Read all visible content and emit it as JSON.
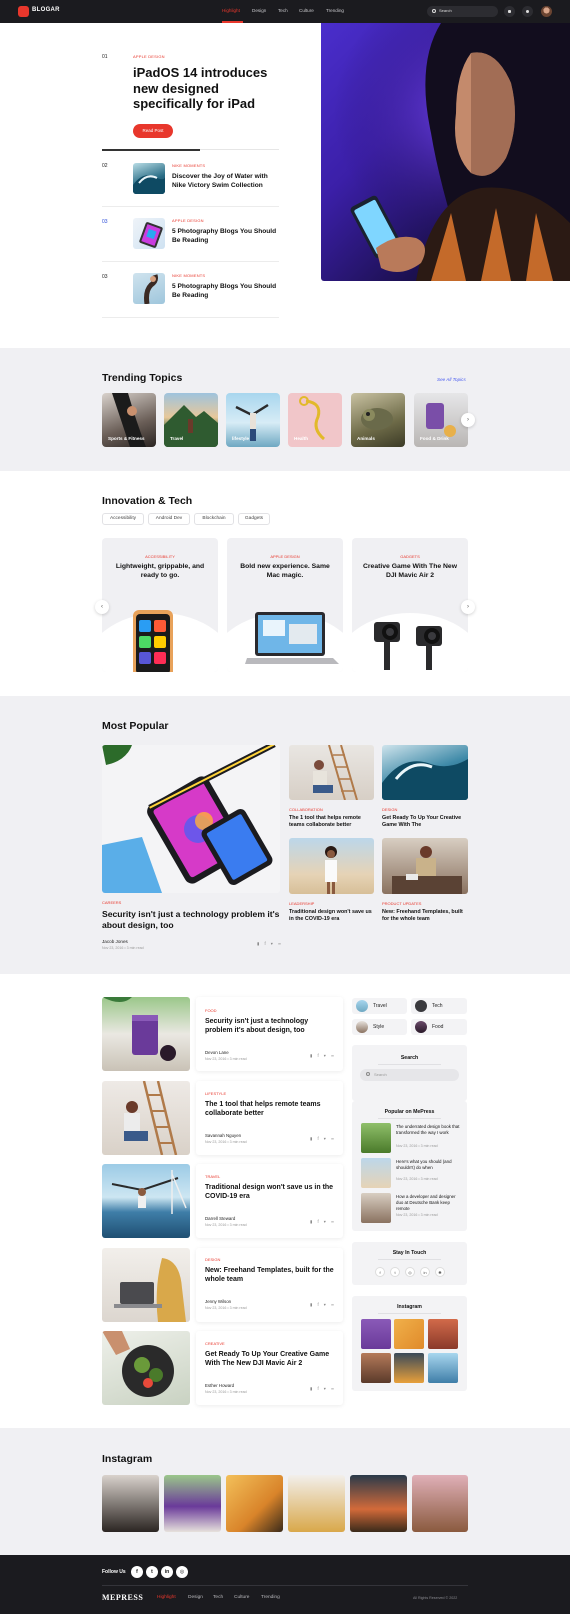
{
  "header": {
    "logo": "BLOGAR",
    "nav": [
      "Highlight",
      "Design",
      "Tech",
      "Culture",
      "Trending"
    ],
    "search_placeholder": "Search"
  },
  "hero": {
    "num": "01",
    "kicker": "APPLE DESIGN",
    "title": "iPadOS 14 introduces new designed specifically for iPad",
    "button": "Read Post",
    "items": [
      {
        "num": "02",
        "kicker": "NIKE MOMENTS",
        "title": "Discover the Joy of Water with Nike Victory Swim Collection"
      },
      {
        "num": "03",
        "kicker": "APPLE DESIGN",
        "title": "5 Photography Blogs You Should Be Reading"
      },
      {
        "num": "03",
        "kicker": "NIKE MOMENTS",
        "title": "5 Photography Blogs You Should Be Reading"
      }
    ]
  },
  "trending": {
    "title": "Trending Topics",
    "see_all": "See All Topics",
    "topics": [
      "Sports & Fitness",
      "Travel",
      "lifestyle",
      "Health",
      "Animals",
      "Food & Drink"
    ]
  },
  "innovation": {
    "title": "Innovation & Tech",
    "tabs": [
      "Accessibility",
      "Android Dev",
      "Blockchain",
      "Gadgets"
    ],
    "cards": [
      {
        "kicker": "ACCESSIBILITY",
        "title": "Lightweight, grippable, and ready to go."
      },
      {
        "kicker": "APPLE DESIGN",
        "title": "Bold new experience. Same Mac magic."
      },
      {
        "kicker": "GADGETS",
        "title": "Creative Game With The New DJI Mavic Air 2"
      }
    ]
  },
  "popular": {
    "title": "Most Popular",
    "main": {
      "kicker": "CAREERS",
      "title": "Security isn't just a technology problem it's about design, too",
      "author": "Jacob Jones",
      "meta": "Nov 23, 2016  •  3 min read"
    },
    "grid": [
      {
        "kicker": "COLLABORATION",
        "title": "The 1 tool that helps remote teams collaborate better"
      },
      {
        "kicker": "DESIGN",
        "title": "Get Ready To Up Your Creative Game With The"
      },
      {
        "kicker": "LEADERSHIP",
        "title": "Traditional design won't save us in the COVID-19 era"
      },
      {
        "kicker": "PRODUCT UPDATES",
        "title": "New: Freehand Templates, built for the whole team"
      }
    ]
  },
  "list": [
    {
      "kicker": "FOOD",
      "title": "Security isn't just a technology problem it's about design, too",
      "author": "Devon Lane",
      "meta": "Nov 23, 2016  •  3 min read"
    },
    {
      "kicker": "LIFESTYLE",
      "title": "The 1 tool that helps remote teams collaborate better",
      "author": "Savannah Nguyen",
      "meta": "Nov 23, 2016  •  3 min read"
    },
    {
      "kicker": "TRAVEL",
      "title": "Traditional design won't save us in the COVID-19 era",
      "author": "Darrell Steward",
      "meta": "Nov 23, 2016  •  3 min read"
    },
    {
      "kicker": "DESIGN",
      "title": "New: Freehand Templates, built for the whole team",
      "author": "Jenny Wilson",
      "meta": "Nov 23, 2016  •  3 min read"
    },
    {
      "kicker": "CREATIVE",
      "title": "Get Ready To Up Your Creative Game With The New DJI Mavic Air 2",
      "author": "Esther Howard",
      "meta": "Nov 23, 2016  •  3 min read"
    }
  ],
  "sidebar": {
    "categories": [
      "Travel",
      "Tech",
      "Style",
      "Food"
    ],
    "search_title": "Search",
    "search_placeholder": "Search",
    "popular_title": "Popular on MePress",
    "popular": [
      {
        "title": "The underrated design book that transformed the way I work",
        "meta": "Nov 23, 2016  •  3 min read"
      },
      {
        "title": "Here's what you should (and shouldn't) do when",
        "meta": "Nov 23, 2016  •  3 min read"
      },
      {
        "title": "How a developer and designer duo at Deutsche Bank keep remote",
        "meta": "Nov 23, 2016  •  3 min read"
      }
    ],
    "stay_title": "Stay In Touch",
    "instagram_title": "Instagram"
  },
  "instagram": {
    "title": "Instagram"
  },
  "footer": {
    "follow": "Follow Us",
    "logo": "MEPRESS",
    "nav": [
      "Highlight",
      "Design",
      "Tech",
      "Culture",
      "Trending"
    ],
    "copyright": "All Rights Reserved © 2022"
  },
  "colors": {
    "accent": "#e8372c",
    "dark": "#1b1b1f",
    "grey_bg": "#f0f0f3",
    "link": "#4a5cf0"
  }
}
